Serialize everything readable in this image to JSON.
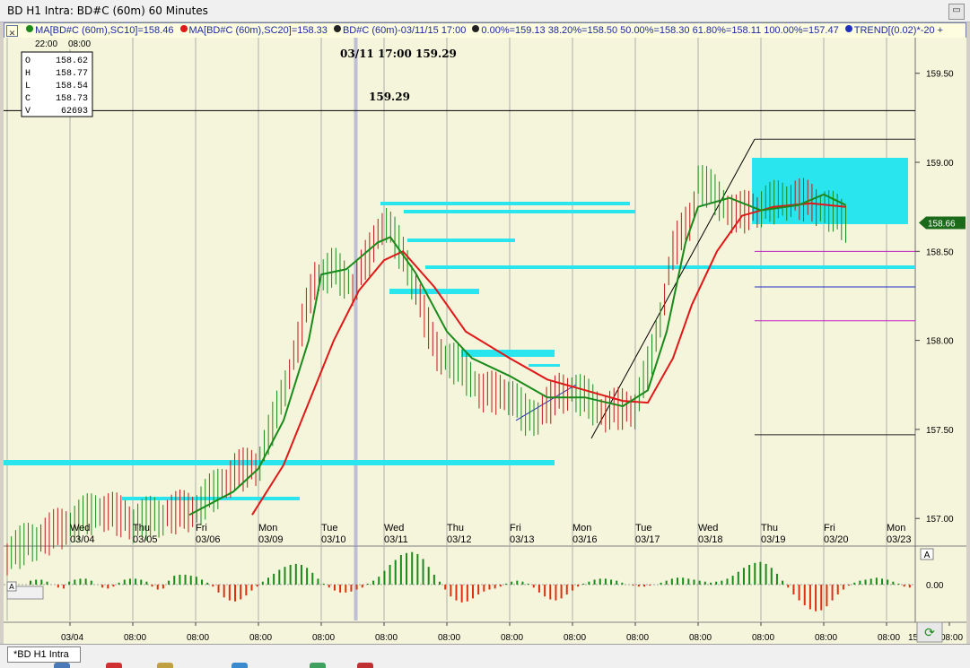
{
  "window": {
    "title": "BD H1 Intra: BD#C (60m) 60 Minutes"
  },
  "legend": {
    "close_glyph": "✕",
    "ma10": "MA[BD#C (60m),SC10]=158.46",
    "ma20": "MA[BD#C (60m),SC20]=158.33",
    "fib": "BD#C (60m)-03/11/15 17:00",
    "levels": "0.00%=159.13 38.20%=158.50 50.00%=158.30 61.80%=158.11 100.00%=157.47",
    "trend": "TREND[(0.02)*-20 +",
    "colors": {
      "ma10": "#1a8a1a",
      "ma20": "#e01818",
      "fib": "#222222",
      "trend": "#2030c0"
    }
  },
  "time_header": {
    "left": "22:00",
    "right": "08:00"
  },
  "ohlcv": [
    {
      "k": "O",
      "v": "158.62"
    },
    {
      "k": "H",
      "v": "158.77"
    },
    {
      "k": "L",
      "v": "158.54"
    },
    {
      "k": "C",
      "v": "158.73"
    },
    {
      "k": "V",
      "v": "62693"
    }
  ],
  "crosshair": {
    "label": "03/11 17:00  159.29",
    "price_label": "159.29",
    "price": 159.29
  },
  "last_price": {
    "label": "158.66",
    "value": 158.66
  },
  "subpanel": {
    "zero_label": "0.00",
    "panel_letter": "A",
    "left_marker": "A"
  },
  "bottom_axis": {
    "labels": [
      "03/04",
      "08:00",
      "08:00",
      "08:00",
      "08:00",
      "08:00",
      "08:00",
      "08:00",
      "08:00",
      "08:00",
      "08:00",
      "08:00",
      "08:00",
      "08:00",
      "08:00"
    ],
    "right_fragment": "15"
  },
  "status": {
    "tab_label": "*BD H1 Intra"
  },
  "chart_data": {
    "type": "candlestick",
    "title": "",
    "y_range": [
      156.85,
      159.7
    ],
    "y_ticks": [
      157.0,
      157.5,
      158.0,
      158.5,
      159.0,
      159.5
    ],
    "y_tick_labels": [
      "157.00",
      "157.50",
      "158.00",
      "158.50",
      "159.00",
      "159.50"
    ],
    "days": [
      {
        "dow": "Wed",
        "date": "03/04"
      },
      {
        "dow": "Thu",
        "date": "03/05"
      },
      {
        "dow": "Fri",
        "date": "03/06"
      },
      {
        "dow": "Mon",
        "date": "03/09"
      },
      {
        "dow": "Tue",
        "date": "03/10"
      },
      {
        "dow": "Wed",
        "date": "03/11"
      },
      {
        "dow": "Thu",
        "date": "03/12"
      },
      {
        "dow": "Fri",
        "date": "03/13"
      },
      {
        "dow": "Mon",
        "date": "03/16"
      },
      {
        "dow": "Tue",
        "date": "03/17"
      },
      {
        "dow": "Wed",
        "date": "03/18"
      },
      {
        "dow": "Thu",
        "date": "03/19"
      },
      {
        "dow": "Fri",
        "date": "03/20"
      },
      {
        "dow": "Mon",
        "date": "03/23"
      }
    ],
    "close_path": [
      {
        "d": 0.0,
        "p": 156.8
      },
      {
        "d": 1.5,
        "p": 157.05
      },
      {
        "d": 2.0,
        "p": 156.98
      },
      {
        "d": 3.0,
        "p": 157.05
      },
      {
        "d": 3.6,
        "p": 157.25
      },
      {
        "d": 4.0,
        "p": 157.3
      },
      {
        "d": 4.3,
        "p": 157.6
      },
      {
        "d": 4.6,
        "p": 157.95
      },
      {
        "d": 4.9,
        "p": 158.35
      },
      {
        "d": 5.2,
        "p": 158.4
      },
      {
        "d": 5.5,
        "p": 158.3
      },
      {
        "d": 5.8,
        "p": 158.5
      },
      {
        "d": 6.0,
        "p": 158.68
      },
      {
        "d": 6.2,
        "p": 158.55
      },
      {
        "d": 6.5,
        "p": 158.3
      },
      {
        "d": 6.8,
        "p": 157.95
      },
      {
        "d": 7.2,
        "p": 157.85
      },
      {
        "d": 7.6,
        "p": 157.7
      },
      {
        "d": 8.0,
        "p": 157.7
      },
      {
        "d": 8.3,
        "p": 157.55
      },
      {
        "d": 8.5,
        "p": 157.6
      },
      {
        "d": 8.8,
        "p": 157.7
      },
      {
        "d": 9.0,
        "p": 157.72
      },
      {
        "d": 9.5,
        "p": 157.6
      },
      {
        "d": 10.0,
        "p": 157.62
      },
      {
        "d": 10.3,
        "p": 157.95
      },
      {
        "d": 10.6,
        "p": 158.5
      },
      {
        "d": 10.9,
        "p": 158.7
      },
      {
        "d": 11.0,
        "p": 158.9
      },
      {
        "d": 11.3,
        "p": 158.8
      },
      {
        "d": 11.6,
        "p": 158.7
      },
      {
        "d": 12.0,
        "p": 158.75
      },
      {
        "d": 12.5,
        "p": 158.8
      },
      {
        "d": 13.0,
        "p": 158.75
      },
      {
        "d": 13.35,
        "p": 158.66
      }
    ],
    "ma10_path": [
      {
        "d": 2.9,
        "p": 157.02
      },
      {
        "d": 3.6,
        "p": 157.15
      },
      {
        "d": 4.0,
        "p": 157.28
      },
      {
        "d": 4.4,
        "p": 157.55
      },
      {
        "d": 4.8,
        "p": 158.0
      },
      {
        "d": 5.0,
        "p": 158.37
      },
      {
        "d": 5.4,
        "p": 158.4
      },
      {
        "d": 5.9,
        "p": 158.55
      },
      {
        "d": 6.1,
        "p": 158.58
      },
      {
        "d": 6.5,
        "p": 158.38
      },
      {
        "d": 7.0,
        "p": 158.05
      },
      {
        "d": 7.4,
        "p": 157.9
      },
      {
        "d": 8.0,
        "p": 157.8
      },
      {
        "d": 8.6,
        "p": 157.68
      },
      {
        "d": 9.2,
        "p": 157.68
      },
      {
        "d": 9.8,
        "p": 157.63
      },
      {
        "d": 10.2,
        "p": 157.72
      },
      {
        "d": 10.5,
        "p": 158.05
      },
      {
        "d": 10.8,
        "p": 158.55
      },
      {
        "d": 11.0,
        "p": 158.75
      },
      {
        "d": 11.5,
        "p": 158.8
      },
      {
        "d": 12.0,
        "p": 158.73
      },
      {
        "d": 12.6,
        "p": 158.76
      },
      {
        "d": 13.0,
        "p": 158.82
      },
      {
        "d": 13.35,
        "p": 158.76
      }
    ],
    "ma20_path": [
      {
        "d": 3.9,
        "p": 157.02
      },
      {
        "d": 4.4,
        "p": 157.3
      },
      {
        "d": 4.8,
        "p": 157.65
      },
      {
        "d": 5.2,
        "p": 158.0
      },
      {
        "d": 5.6,
        "p": 158.28
      },
      {
        "d": 6.0,
        "p": 158.45
      },
      {
        "d": 6.3,
        "p": 158.5
      },
      {
        "d": 6.8,
        "p": 158.3
      },
      {
        "d": 7.3,
        "p": 158.05
      },
      {
        "d": 8.0,
        "p": 157.9
      },
      {
        "d": 8.6,
        "p": 157.78
      },
      {
        "d": 9.2,
        "p": 157.72
      },
      {
        "d": 9.8,
        "p": 157.66
      },
      {
        "d": 10.2,
        "p": 157.65
      },
      {
        "d": 10.6,
        "p": 157.9
      },
      {
        "d": 10.9,
        "p": 158.2
      },
      {
        "d": 11.3,
        "p": 158.5
      },
      {
        "d": 11.7,
        "p": 158.7
      },
      {
        "d": 12.2,
        "p": 158.75
      },
      {
        "d": 12.8,
        "p": 158.77
      },
      {
        "d": 13.35,
        "p": 158.75
      }
    ],
    "fib_levels": [
      {
        "label": "0.00%",
        "price": 159.13,
        "color": "#222222"
      },
      {
        "label": "38.20%",
        "price": 158.5,
        "color": "#c020c0"
      },
      {
        "label": "50.00%",
        "price": 158.3,
        "color": "#2030c0"
      },
      {
        "label": "61.80%",
        "price": 158.11,
        "color": "#c020c0"
      },
      {
        "label": "100.00%",
        "price": 157.47,
        "color": "#222222"
      }
    ],
    "macd": [
      0.04,
      0.05,
      0.05,
      0.03,
      0.0,
      -0.03,
      -0.04,
      0.03,
      0.05,
      0.06,
      0.06,
      0.04,
      0.0,
      -0.03,
      -0.04,
      -0.02,
      0.02,
      0.05,
      0.06,
      0.06,
      0.05,
      0.03,
      -0.02,
      -0.05,
      -0.04,
      0.04,
      0.09,
      0.1,
      0.1,
      0.09,
      0.08,
      0.05,
      0.02,
      -0.02,
      -0.08,
      -0.13,
      -0.16,
      -0.17,
      -0.15,
      -0.11,
      -0.06,
      -0.02,
      0.03,
      0.07,
      0.11,
      0.15,
      0.18,
      0.2,
      0.21,
      0.2,
      0.17,
      0.12,
      0.06,
      0.01,
      -0.03,
      -0.06,
      -0.08,
      -0.08,
      -0.07,
      -0.05,
      -0.03,
      0.01,
      0.04,
      0.08,
      0.14,
      0.2,
      0.25,
      0.3,
      0.32,
      0.33,
      0.31,
      0.26,
      0.18,
      0.1,
      0.03,
      -0.05,
      -0.12,
      -0.16,
      -0.18,
      -0.17,
      -0.14,
      -0.1,
      -0.07,
      -0.05,
      -0.04,
      -0.02,
      0.01,
      0.03,
      0.04,
      0.03,
      0.01,
      -0.03,
      -0.08,
      -0.12,
      -0.15,
      -0.16,
      -0.14,
      -0.1,
      -0.06,
      -0.02,
      0.01,
      0.03,
      0.05,
      0.06,
      0.06,
      0.05,
      0.04,
      0.02,
      0.0,
      -0.01,
      -0.02,
      -0.02,
      -0.01,
      0.0,
      0.02,
      0.04,
      0.06,
      0.07,
      0.07,
      0.06,
      0.05,
      0.04,
      0.03,
      0.02,
      0.03,
      0.04,
      0.06,
      0.09,
      0.13,
      0.17,
      0.2,
      0.22,
      0.23,
      0.21,
      0.17,
      0.11,
      0.04,
      -0.03,
      -0.1,
      -0.16,
      -0.21,
      -0.25,
      -0.27,
      -0.26,
      -0.22,
      -0.16,
      -0.1,
      -0.05,
      -0.01,
      0.02,
      0.04,
      0.05,
      0.06,
      0.07,
      0.06,
      0.05,
      0.03,
      0.01,
      -0.02,
      -0.03
    ]
  }
}
